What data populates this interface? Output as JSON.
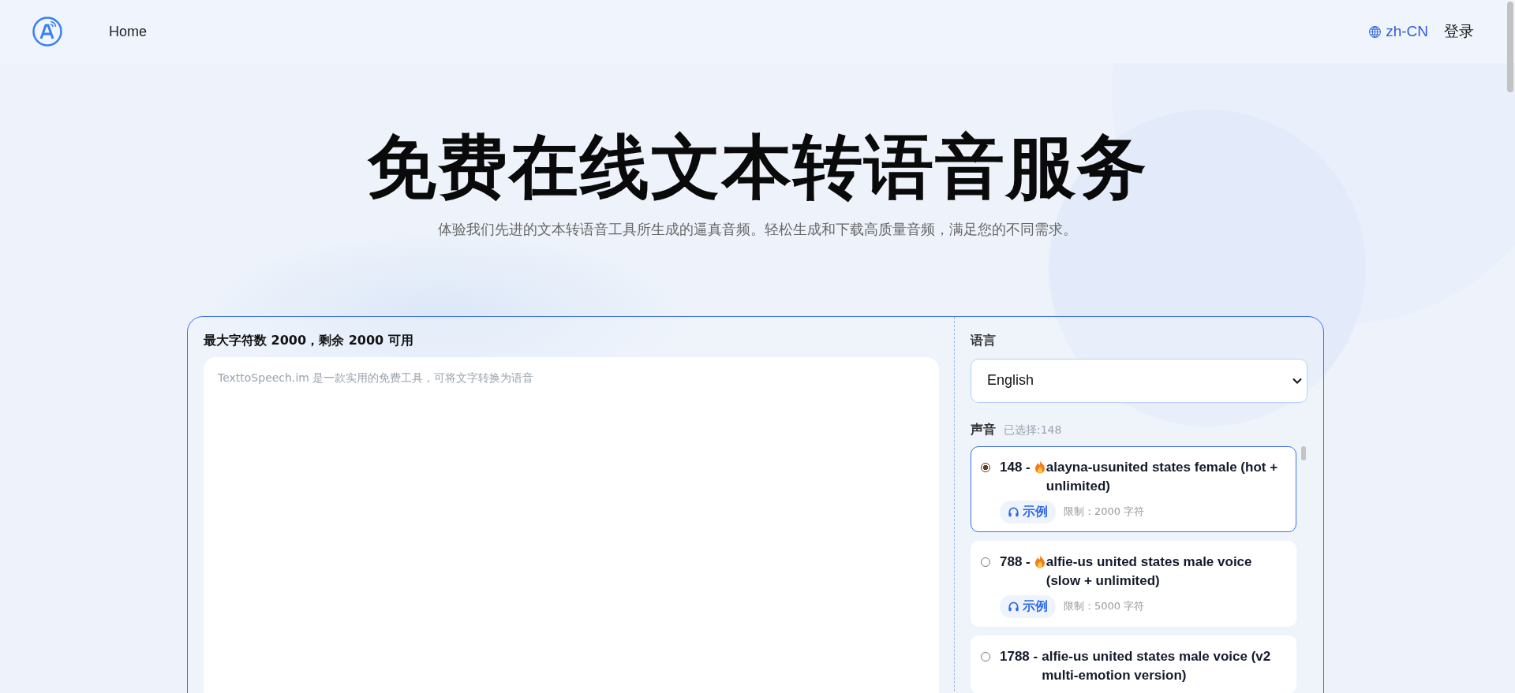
{
  "header": {
    "nav": [
      {
        "label": "Home"
      }
    ],
    "language": "zh-CN",
    "login": "登录"
  },
  "hero": {
    "title": "免费在线文本转语音服务",
    "subtitle": "体验我们先进的文本转语音工具所生成的逼真音频。轻松生成和下载高质量音频，满足您的不同需求。"
  },
  "editor": {
    "counter": "最大字符数 2000，剩余 2000 可用",
    "placeholder": "TexttoSpeech.im 是一款实用的免费工具，可将文字转换为语音"
  },
  "settings": {
    "language_label": "语言",
    "language_value": "English",
    "voice_label": "声音",
    "voice_selected": "已选择:148",
    "voices": [
      {
        "number": "148 -",
        "hot": true,
        "name": "alayna-usunited states female (hot + unlimited)",
        "selected": true,
        "sample": "示例",
        "limit": "限制：2000 字符"
      },
      {
        "number": "788 -",
        "hot": true,
        "name": "alfie-us united states male voice (slow + unlimited)",
        "selected": false,
        "sample": "示例",
        "limit": "限制：5000 字符"
      },
      {
        "number": "1788 -",
        "hot": false,
        "name": "alfie-us united states male voice (v2 multi-emotion version)",
        "selected": false
      }
    ]
  }
}
